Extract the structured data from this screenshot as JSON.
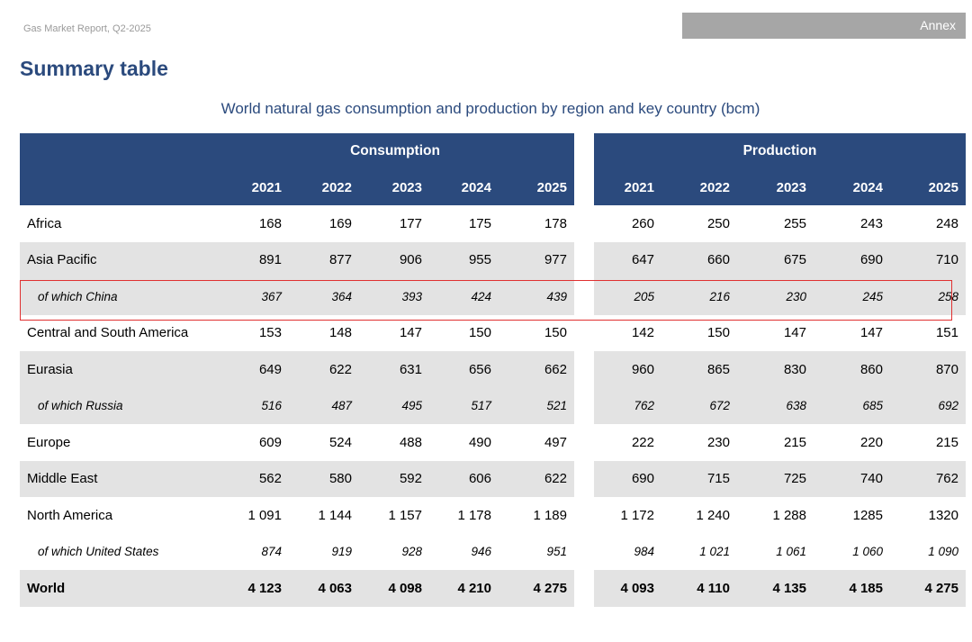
{
  "header": {
    "report_name": "Gas Market Report, Q2-2025",
    "section": "Annex"
  },
  "page_title": "Summary table",
  "table": {
    "title": "World natural gas consumption and production by region and key country (bcm)",
    "groups": [
      "Consumption",
      "Production"
    ],
    "years": [
      "2021",
      "2022",
      "2023",
      "2024",
      "2025"
    ],
    "rows": [
      {
        "region": "Africa",
        "style": "normal",
        "consumption": [
          "168",
          "169",
          "177",
          "175",
          "178"
        ],
        "production": [
          "260",
          "250",
          "255",
          "243",
          "248"
        ]
      },
      {
        "region": "Asia Pacific",
        "style": "shaded",
        "consumption": [
          "891",
          "877",
          "906",
          "955",
          "977"
        ],
        "production": [
          "647",
          "660",
          "675",
          "690",
          "710"
        ]
      },
      {
        "region": "of which China",
        "style": "sub-shaded",
        "consumption": [
          "367",
          "364",
          "393",
          "424",
          "439"
        ],
        "production": [
          "205",
          "216",
          "230",
          "245",
          "258"
        ]
      },
      {
        "region": "Central and South America",
        "style": "normal",
        "consumption": [
          "153",
          "148",
          "147",
          "150",
          "150"
        ],
        "production": [
          "142",
          "150",
          "147",
          "147",
          "151"
        ]
      },
      {
        "region": "Eurasia",
        "style": "shaded",
        "consumption": [
          "649",
          "622",
          "631",
          "656",
          "662"
        ],
        "production": [
          "960",
          "865",
          "830",
          "860",
          "870"
        ]
      },
      {
        "region": "of which Russia",
        "style": "sub-shaded",
        "consumption": [
          "516",
          "487",
          "495",
          "517",
          "521"
        ],
        "production": [
          "762",
          "672",
          "638",
          "685",
          "692"
        ]
      },
      {
        "region": "Europe",
        "style": "normal",
        "consumption": [
          "609",
          "524",
          "488",
          "490",
          "497"
        ],
        "production": [
          "222",
          "230",
          "215",
          "220",
          "215"
        ]
      },
      {
        "region": "Middle East",
        "style": "shaded",
        "consumption": [
          "562",
          "580",
          "592",
          "606",
          "622"
        ],
        "production": [
          "690",
          "715",
          "725",
          "740",
          "762"
        ]
      },
      {
        "region": "North America",
        "style": "normal",
        "consumption": [
          "1 091",
          "1 144",
          "1 157",
          "1 178",
          "1 189"
        ],
        "production": [
          "1 172",
          "1 240",
          "1 288",
          "1285",
          "1320"
        ]
      },
      {
        "region": "of which United States",
        "style": "sub",
        "consumption": [
          "874",
          "919",
          "928",
          "946",
          "951"
        ],
        "production": [
          "984",
          "1 021",
          "1 061",
          "1 060",
          "1 090"
        ]
      },
      {
        "region": "World",
        "style": "total",
        "consumption": [
          "4 123",
          "4 063",
          "4 098",
          "4 210",
          "4 275"
        ],
        "production": [
          "4 093",
          "4 110",
          "4 135",
          "4 185",
          "4 275"
        ]
      }
    ]
  },
  "colors": {
    "header_bg": "#2b4a7d",
    "shaded_row": "#e3e3e3",
    "annex_bar": "#a6a6a6",
    "highlight_border": "#e03030"
  }
}
